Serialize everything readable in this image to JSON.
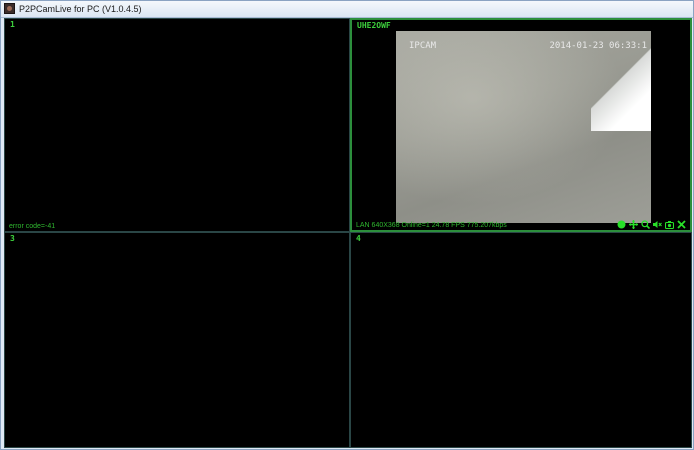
{
  "window": {
    "title": "P2PCamLive for PC (V1.0.4.5)"
  },
  "panes": [
    {
      "label": "1",
      "status": "error code=-41"
    },
    {
      "label": "UHE2OWF",
      "status": "LAN  640X368  Online=1  24.78 FPS  775.207kbps",
      "video": {
        "brand": "IPCAM",
        "timestamp": "2014-01-23 06:33:1"
      },
      "toolbar": [
        "record-dot-icon",
        "ptz-move-icon",
        "zoom-icon",
        "mute-speaker-icon",
        "snapshot-camera-icon",
        "close-icon"
      ]
    },
    {
      "label": "3",
      "status": ""
    },
    {
      "label": "4",
      "status": ""
    }
  ],
  "colors": {
    "label_green": "#3dd03d",
    "active_border": "#2c8f3c",
    "pane_border": "#2a4646"
  }
}
